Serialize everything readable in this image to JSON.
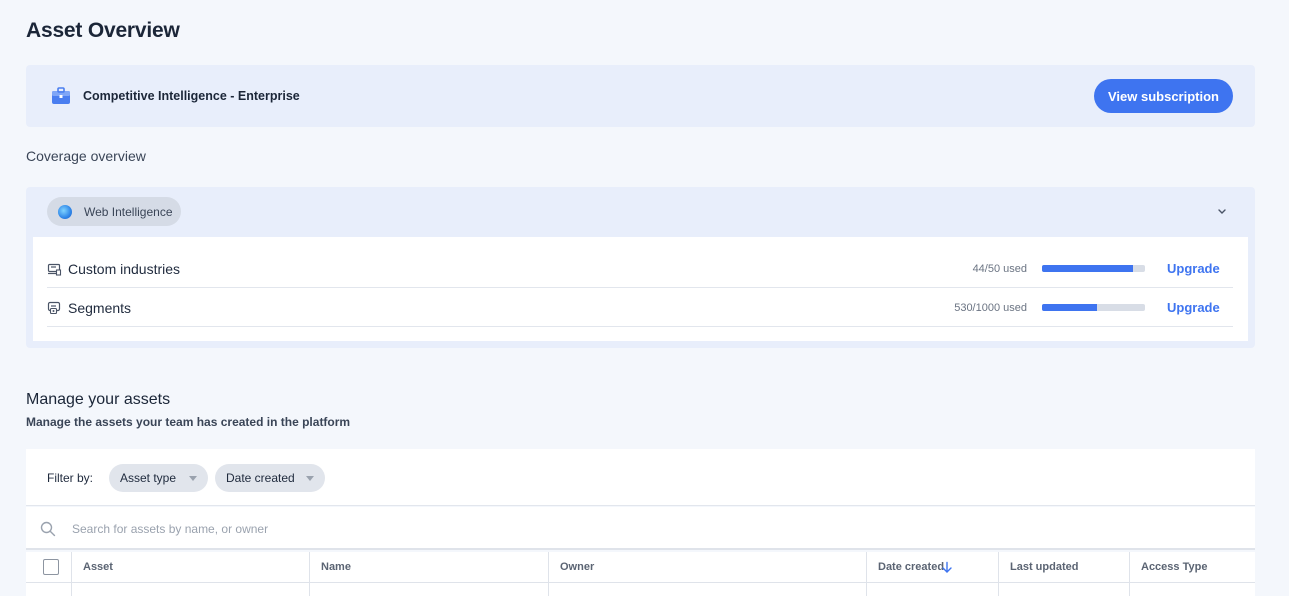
{
  "page": {
    "title": "Asset Overview"
  },
  "subscription": {
    "name": "Competitive Intelligence - Enterprise",
    "button_label": "View subscription",
    "icon": "briefcase-icon"
  },
  "coverage": {
    "title": "Coverage overview",
    "product": {
      "label": "Web Intelligence",
      "icon": "globe-icon"
    },
    "rows": [
      {
        "label": "Custom industries",
        "usage": "44/50 used",
        "used": 44,
        "limit": 50,
        "action": "Upgrade",
        "icon": "industry-icon"
      },
      {
        "label": "Segments",
        "usage": "530/1000 used",
        "used": 530,
        "limit": 1000,
        "action": "Upgrade",
        "icon": "segments-icon"
      }
    ]
  },
  "assets": {
    "title": "Manage your assets",
    "subtitle": "Manage the assets your team has created in the platform",
    "filter_label": "Filter by:",
    "filters": [
      "Asset type",
      "Date created"
    ],
    "search_placeholder": "Search for assets by name, or owner",
    "columns": [
      "Asset",
      "Name",
      "Owner",
      "Date created",
      "Last updated",
      "Access Type"
    ],
    "sorted_column": "Date created",
    "sort_direction": "descending"
  },
  "colors": {
    "accent": "#3e74f0",
    "banner_bg": "#e8eefb",
    "page_bg": "#f4f7fc"
  }
}
